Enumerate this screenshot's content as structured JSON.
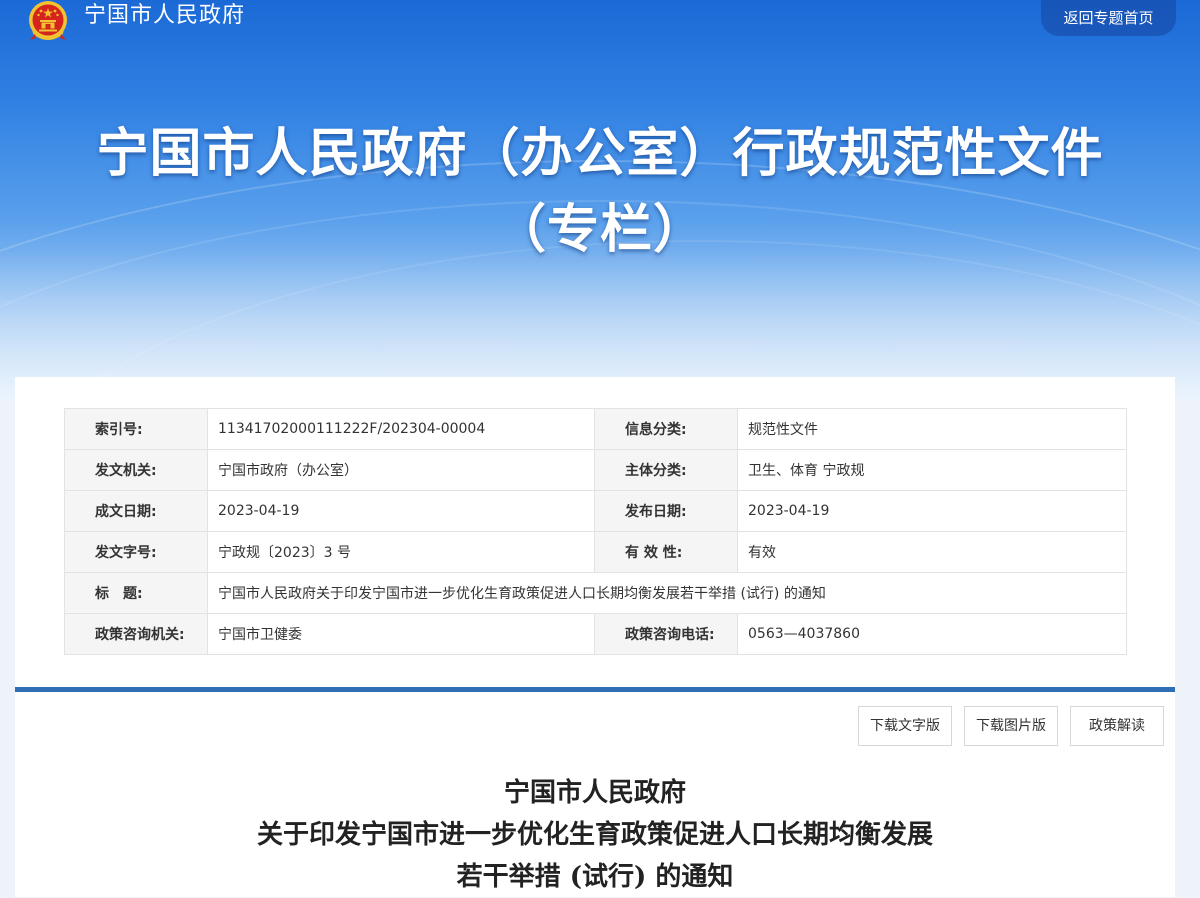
{
  "header": {
    "site_name": "宁国市人民政府",
    "back_button": "返回专题首页",
    "banner_title_line1": "宁国市人民政府（办公室）行政规范性文件",
    "banner_title_line2": "（专栏）"
  },
  "info_table": {
    "rows": [
      {
        "label1": "索引号:",
        "value1": "11341702000111222F/202304-00004",
        "label2": "信息分类:",
        "value2": "规范性文件"
      },
      {
        "label1": "发文机关:",
        "value1": "宁国市政府（办公室）",
        "label2": "主体分类:",
        "value2": "卫生、体育 宁政规"
      },
      {
        "label1": "成文日期:",
        "value1": "2023-04-19",
        "label2": "发布日期:",
        "value2": "2023-04-19"
      },
      {
        "label1": "发文字号:",
        "value1": "宁政规〔2023〕3 号",
        "label2": "有 效 性:",
        "value2": "有效"
      },
      {
        "label1": "标　题:",
        "value1": "宁国市人民政府关于印发宁国市进一步优化生育政策促进人口长期均衡发展若干举措 (试行) 的通知"
      },
      {
        "label1": "政策咨询机关:",
        "value1": "宁国市卫健委",
        "label2": "政策咨询电话:",
        "value2": "0563—4037860"
      }
    ]
  },
  "doc_actions": {
    "download_text": "下载文字版",
    "download_image": "下载图片版",
    "policy_interpretation": "政策解读"
  },
  "document": {
    "title_line1": "宁国市人民政府",
    "title_line2": "关于印发宁国市进一步优化生育政策促进人口长期均衡发展",
    "title_line3": "若干举措 (试行) 的通知"
  },
  "colors": {
    "banner_blue": "#2f80e3",
    "divider_blue": "#2f6db5",
    "emblem_red": "#d4241b",
    "emblem_gold": "#f2c230"
  },
  "icons": {
    "emblem": "national-emblem-icon"
  }
}
